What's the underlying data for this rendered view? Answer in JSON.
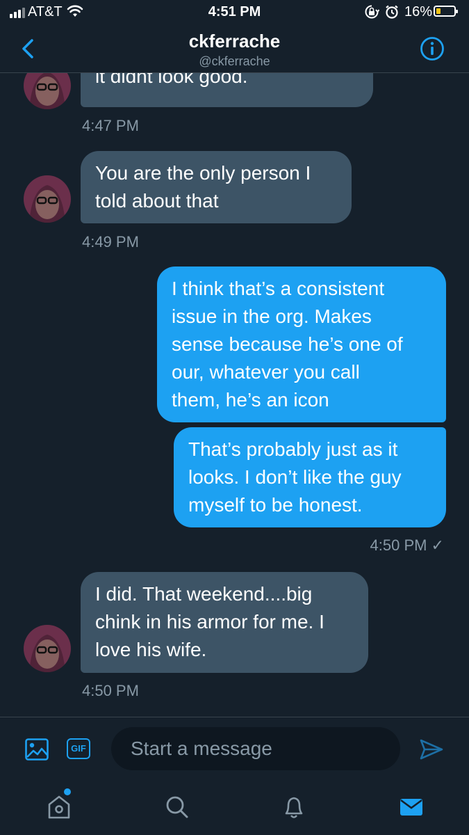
{
  "status_bar": {
    "carrier": "AT&T",
    "time": "4:51 PM",
    "battery_percent": "16%",
    "battery_level": 0.16,
    "icons": [
      "signal-icon",
      "wifi-icon",
      "rotation-lock-icon",
      "alarm-icon",
      "battery-icon"
    ]
  },
  "header": {
    "title": "ckferrache",
    "handle": "@ckferrache",
    "back_icon": "chevron-left-icon",
    "info_icon": "info-icon"
  },
  "colors": {
    "background": "#15202b",
    "incoming_bubble": "#3d5466",
    "outgoing_bubble": "#1da1f2",
    "accent": "#1da1f2",
    "muted_text": "#8899a6"
  },
  "messages": [
    {
      "direction": "incoming",
      "lines": [
        "it didnt look good."
      ],
      "timestamp": "4:47 PM"
    },
    {
      "direction": "incoming",
      "lines": [
        "You are the only person I",
        "told about that"
      ],
      "timestamp": "4:49 PM"
    },
    {
      "direction": "outgoing",
      "lines": [
        "I think that’s a consistent",
        "issue in the org. Makes",
        "sense because he’s one of",
        "our, whatever you call",
        "them, he’s an icon"
      ]
    },
    {
      "direction": "outgoing",
      "lines": [
        "That’s probably just as it",
        "looks. I don’t like the guy",
        "myself to be honest."
      ],
      "timestamp": "4:50 PM ✓"
    },
    {
      "direction": "incoming",
      "lines": [
        "I did. That weekend....big",
        "chink in his armor for me. I",
        "love his wife."
      ],
      "timestamp": "4:50 PM"
    }
  ],
  "composer": {
    "placeholder": "Start a message",
    "gif_label": "GIF",
    "image_icon": "image-icon",
    "send_icon": "send-icon"
  },
  "tabbar": {
    "tabs": [
      "home-icon",
      "search-icon",
      "notifications-icon",
      "messages-icon"
    ],
    "active_tab": "messages-icon"
  }
}
